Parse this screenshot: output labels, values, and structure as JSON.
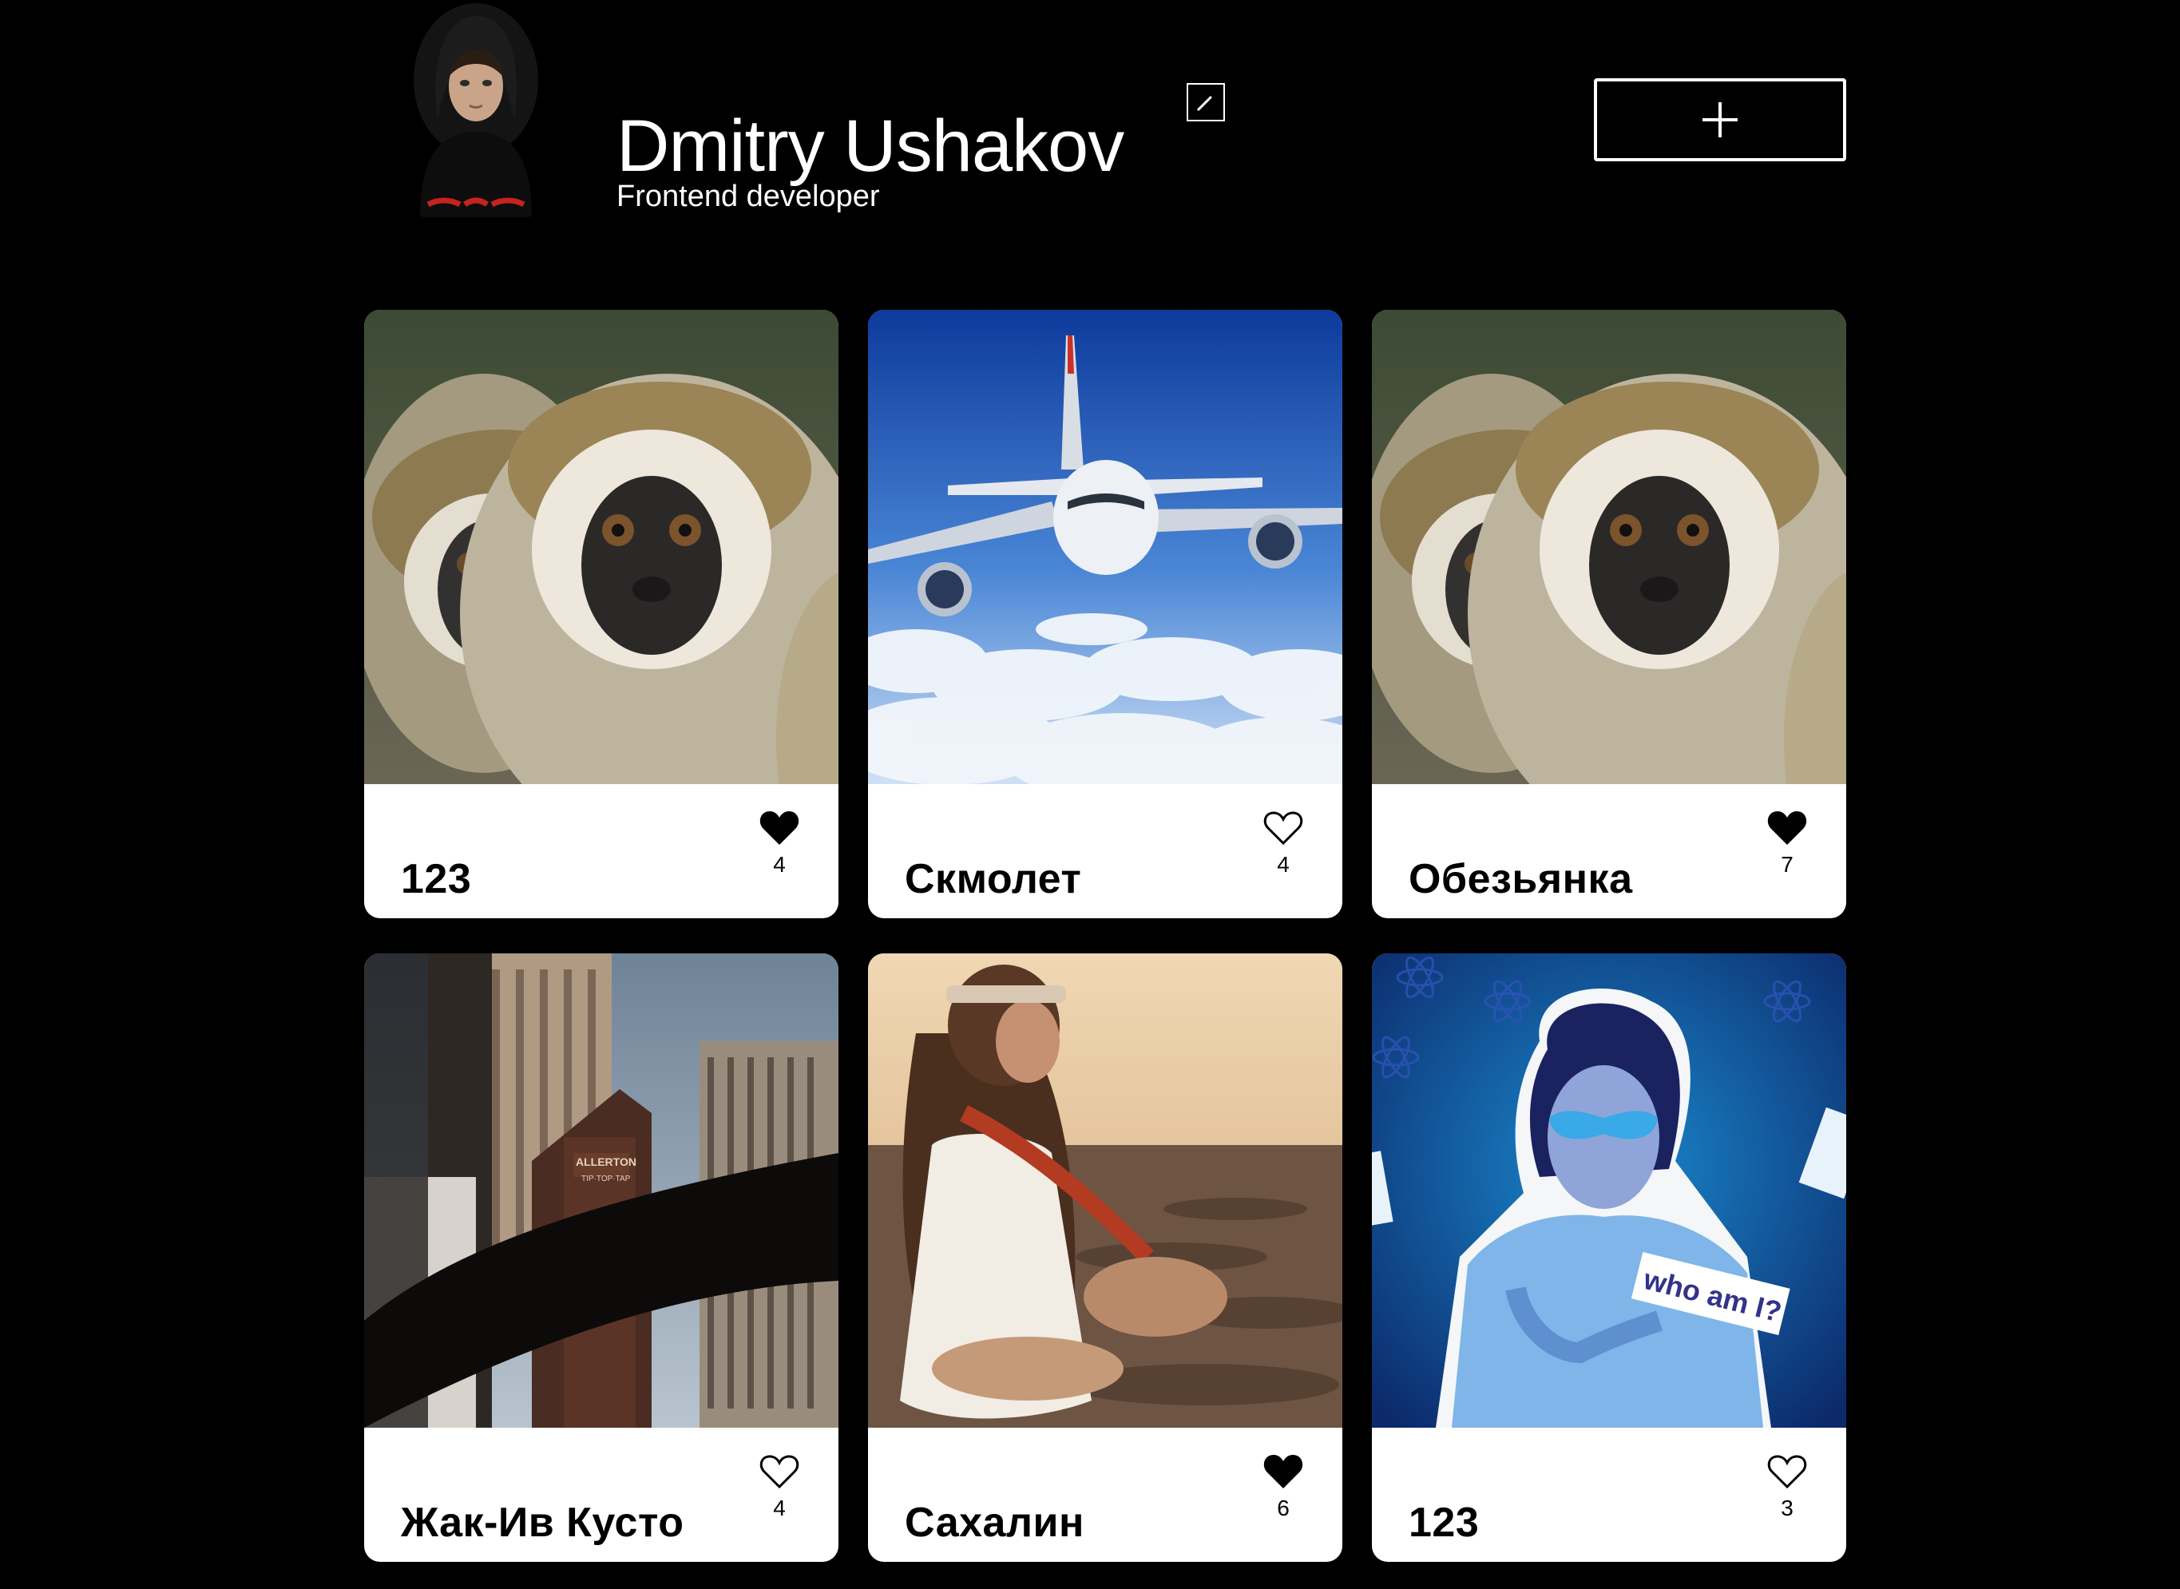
{
  "profile": {
    "name": "Dmitry Ushakov",
    "job": "Frontend developer",
    "avatar_icon": "avatar-photo",
    "edit_icon": "pencil-icon",
    "add_icon": "plus-icon"
  },
  "colors": {
    "background": "#000000",
    "card_background": "#ffffff",
    "text_primary": "#ffffff",
    "card_text": "#000000",
    "like_active": "#000000"
  },
  "cards": [
    {
      "title": "123",
      "likes": "4",
      "liked": true,
      "image": "monkeys-photo"
    },
    {
      "title": "Скмолет",
      "likes": "4",
      "liked": false,
      "image": "airplane-photo"
    },
    {
      "title": "Обезьянка",
      "likes": "7",
      "liked": true,
      "image": "monkeys-photo"
    },
    {
      "title": "Жак-Ив Кусто",
      "likes": "4",
      "liked": false,
      "image": "city-buildings-photo"
    },
    {
      "title": "Сахалин",
      "likes": "6",
      "liked": true,
      "image": "girl-on-beach-photo"
    },
    {
      "title": "123",
      "likes": "3",
      "liked": false,
      "image": "who-am-i-poster"
    }
  ]
}
